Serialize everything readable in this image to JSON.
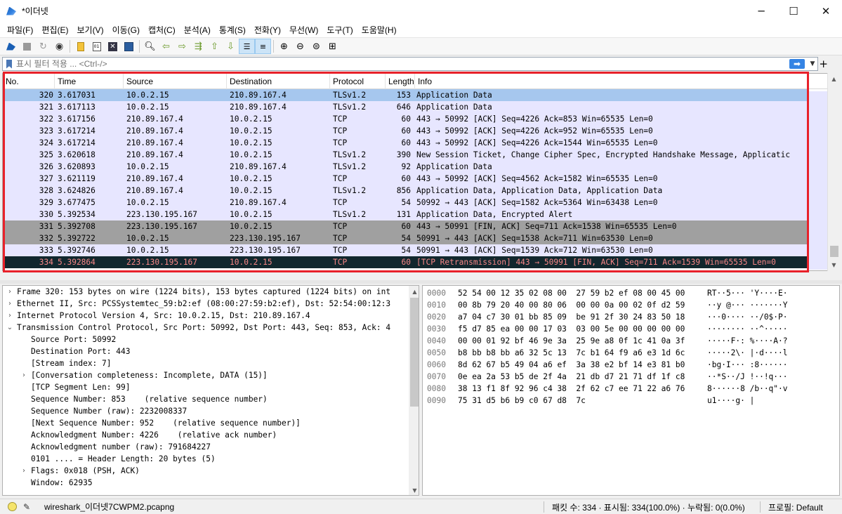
{
  "window": {
    "title": "*이더넷",
    "minimize": "─",
    "maximize": "☐",
    "close": "✕"
  },
  "menu": [
    "파일(F)",
    "편집(E)",
    "보기(V)",
    "이동(G)",
    "캡처(C)",
    "분석(A)",
    "통계(S)",
    "전화(Y)",
    "무선(W)",
    "도구(T)",
    "도움말(H)"
  ],
  "filter": {
    "placeholder": "표시 필터 적용 ... <Ctrl-/>",
    "apply_icon": "arrow-right-icon",
    "add_label": "+"
  },
  "packet_list": {
    "columns": [
      "No.",
      "Time",
      "Source",
      "Destination",
      "Protocol",
      "Length",
      "Info"
    ],
    "rows": [
      {
        "no": "320",
        "time": "3.617031",
        "src": "10.0.2.15",
        "dst": "210.89.167.4",
        "proto": "TLSv1.2",
        "len": "153",
        "info": "Application Data",
        "style": "selected"
      },
      {
        "no": "321",
        "time": "3.617113",
        "src": "10.0.2.15",
        "dst": "210.89.167.4",
        "proto": "TLSv1.2",
        "len": "646",
        "info": "Application Data",
        "style": "tcp"
      },
      {
        "no": "322",
        "time": "3.617156",
        "src": "210.89.167.4",
        "dst": "10.0.2.15",
        "proto": "TCP",
        "len": "60",
        "info": "443 → 50992 [ACK] Seq=4226 Ack=853 Win=65535 Len=0",
        "style": "tcp"
      },
      {
        "no": "323",
        "time": "3.617214",
        "src": "210.89.167.4",
        "dst": "10.0.2.15",
        "proto": "TCP",
        "len": "60",
        "info": "443 → 50992 [ACK] Seq=4226 Ack=952 Win=65535 Len=0",
        "style": "tcp"
      },
      {
        "no": "324",
        "time": "3.617214",
        "src": "210.89.167.4",
        "dst": "10.0.2.15",
        "proto": "TCP",
        "len": "60",
        "info": "443 → 50992 [ACK] Seq=4226 Ack=1544 Win=65535 Len=0",
        "style": "tcp"
      },
      {
        "no": "325",
        "time": "3.620618",
        "src": "210.89.167.4",
        "dst": "10.0.2.15",
        "proto": "TLSv1.2",
        "len": "390",
        "info": "New Session Ticket, Change Cipher Spec, Encrypted Handshake Message, Applicatic",
        "style": "tcp"
      },
      {
        "no": "326",
        "time": "3.620893",
        "src": "10.0.2.15",
        "dst": "210.89.167.4",
        "proto": "TLSv1.2",
        "len": "92",
        "info": "Application Data",
        "style": "tcp"
      },
      {
        "no": "327",
        "time": "3.621119",
        "src": "210.89.167.4",
        "dst": "10.0.2.15",
        "proto": "TCP",
        "len": "60",
        "info": "443 → 50992 [ACK] Seq=4562 Ack=1582 Win=65535 Len=0",
        "style": "tcp"
      },
      {
        "no": "328",
        "time": "3.624826",
        "src": "210.89.167.4",
        "dst": "10.0.2.15",
        "proto": "TLSv1.2",
        "len": "856",
        "info": "Application Data, Application Data, Application Data",
        "style": "tcp"
      },
      {
        "no": "329",
        "time": "3.677475",
        "src": "10.0.2.15",
        "dst": "210.89.167.4",
        "proto": "TCP",
        "len": "54",
        "info": "50992 → 443 [ACK] Seq=1582 Ack=5364 Win=63438 Len=0",
        "style": "tcp"
      },
      {
        "no": "330",
        "time": "5.392534",
        "src": "223.130.195.167",
        "dst": "10.0.2.15",
        "proto": "TLSv1.2",
        "len": "131",
        "info": "Application Data, Encrypted Alert",
        "style": "tcp"
      },
      {
        "no": "331",
        "time": "5.392708",
        "src": "223.130.195.167",
        "dst": "10.0.2.15",
        "proto": "TCP",
        "len": "60",
        "info": "443 → 50991 [FIN, ACK] Seq=711 Ack=1538 Win=65535 Len=0",
        "style": "fin"
      },
      {
        "no": "332",
        "time": "5.392722",
        "src": "10.0.2.15",
        "dst": "223.130.195.167",
        "proto": "TCP",
        "len": "54",
        "info": "50991 → 443 [ACK] Seq=1538 Ack=711 Win=63530 Len=0",
        "style": "fin"
      },
      {
        "no": "333",
        "time": "5.392746",
        "src": "10.0.2.15",
        "dst": "223.130.195.167",
        "proto": "TCP",
        "len": "54",
        "info": "50991 → 443 [ACK] Seq=1539 Ack=712 Win=63530 Len=0",
        "style": "tcp"
      },
      {
        "no": "334",
        "time": "5.392864",
        "src": "223.130.195.167",
        "dst": "10.0.2.15",
        "proto": "TCP",
        "len": "60",
        "info": "[TCP Retransmission] 443 → 50991 [FIN, ACK] Seq=711 Ack=1539 Win=65535 Len=0",
        "style": "bad"
      }
    ]
  },
  "details": [
    {
      "arrow": "›",
      "indent": 0,
      "text": "Frame 320: 153 bytes on wire (1224 bits), 153 bytes captured (1224 bits) on int"
    },
    {
      "arrow": "›",
      "indent": 0,
      "text": "Ethernet II, Src: PCSSystemtec_59:b2:ef (08:00:27:59:b2:ef), Dst: 52:54:00:12:3"
    },
    {
      "arrow": "›",
      "indent": 0,
      "text": "Internet Protocol Version 4, Src: 10.0.2.15, Dst: 210.89.167.4"
    },
    {
      "arrow": "⌄",
      "indent": 0,
      "text": "Transmission Control Protocol, Src Port: 50992, Dst Port: 443, Seq: 853, Ack: 4"
    },
    {
      "arrow": "",
      "indent": 1,
      "text": "Source Port: 50992"
    },
    {
      "arrow": "",
      "indent": 1,
      "text": "Destination Port: 443"
    },
    {
      "arrow": "",
      "indent": 1,
      "text": "[Stream index: 7]"
    },
    {
      "arrow": "›",
      "indent": 1,
      "text": "[Conversation completeness: Incomplete, DATA (15)]"
    },
    {
      "arrow": "",
      "indent": 1,
      "text": "[TCP Segment Len: 99]"
    },
    {
      "arrow": "",
      "indent": 1,
      "text": "Sequence Number: 853    (relative sequence number)"
    },
    {
      "arrow": "",
      "indent": 1,
      "text": "Sequence Number (raw): 2232008337"
    },
    {
      "arrow": "",
      "indent": 1,
      "text": "[Next Sequence Number: 952    (relative sequence number)]"
    },
    {
      "arrow": "",
      "indent": 1,
      "text": "Acknowledgment Number: 4226    (relative ack number)"
    },
    {
      "arrow": "",
      "indent": 1,
      "text": "Acknowledgment number (raw): 791684227"
    },
    {
      "arrow": "",
      "indent": 1,
      "text": "0101 .... = Header Length: 20 bytes (5)"
    },
    {
      "arrow": "›",
      "indent": 1,
      "text": "Flags: 0x018 (PSH, ACK)"
    },
    {
      "arrow": "",
      "indent": 1,
      "text": "Window: 62935"
    }
  ],
  "bytes": [
    {
      "off": "0000",
      "hex": "52 54 00 12 35 02 08 00  27 59 b2 ef 08 00 45 00",
      "ascii": "RT··5··· 'Y····E·"
    },
    {
      "off": "0010",
      "hex": "00 8b 79 20 40 00 80 06  00 00 0a 00 02 0f d2 59",
      "ascii": "··y @··· ·······Y"
    },
    {
      "off": "0020",
      "hex": "a7 04 c7 30 01 bb 85 09  be 91 2f 30 24 83 50 18",
      "ascii": "···0···· ··/0$·P·"
    },
    {
      "off": "0030",
      "hex": "f5 d7 85 ea 00 00 17 03  03 00 5e 00 00 00 00 00",
      "ascii": "········ ··^·····"
    },
    {
      "off": "0040",
      "hex": "00 00 01 92 bf 46 9e 3a  25 9e a8 0f 1c 41 0a 3f",
      "ascii": "·····F·: %····A·?"
    },
    {
      "off": "0050",
      "hex": "b8 bb b8 bb a6 32 5c 13  7c b1 64 f9 a6 e3 1d 6c",
      "ascii": "·····2\\· |·d····l"
    },
    {
      "off": "0060",
      "hex": "8d 62 67 b5 49 04 a6 ef  3a 38 e2 bf 14 e3 81 b0",
      "ascii": "·bg·I··· :8······"
    },
    {
      "off": "0070",
      "hex": "0e ea 2a 53 b5 de 2f 4a  21 db d7 21 71 df 1f c8",
      "ascii": "··*S··/J !··!q···"
    },
    {
      "off": "0080",
      "hex": "38 13 f1 8f 92 96 c4 38  2f 62 c7 ee 71 22 a6 76",
      "ascii": "8······8 /b··q\"·v"
    },
    {
      "off": "0090",
      "hex": "75 31 d5 b6 b9 c0 67 d8  7c",
      "ascii": "u1····g· |"
    }
  ],
  "status": {
    "file": "wireshark_이더넷7CWPM2.pcapng",
    "stats": "패킷 수: 334 · 표시됨: 334(100.0%) · 누락됨: 0(0.0%)",
    "profile": "프로필: Default"
  },
  "colors": {
    "selected": "#a6c7ee",
    "tcp": "#e7e6ff",
    "fin": "#a0a0a0",
    "bad_bg": "#12272e",
    "bad_fg": "#f78787",
    "highlight": "#e8212a"
  }
}
